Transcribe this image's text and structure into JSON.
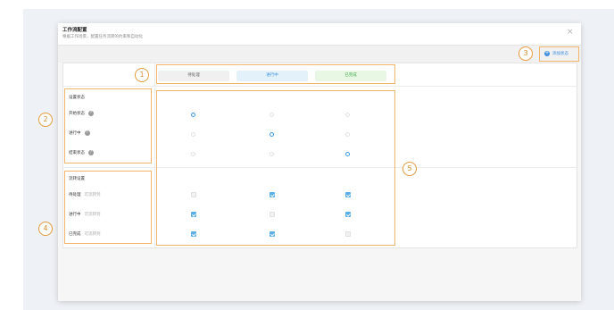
{
  "modal": {
    "title": "工作流配置",
    "subtitle": "根据工作场景，配置任务流转的约束和自动化",
    "close_label": "×"
  },
  "toolbar": {
    "add_status_label": "添加状态"
  },
  "statuses": [
    "待处理",
    "进行中",
    "已完成"
  ],
  "status_settings": {
    "heading": "设置状态",
    "rows": [
      {
        "label": "开始状态",
        "icon": "info-icon"
      },
      {
        "label": "进行中",
        "icon": "info-icon"
      },
      {
        "label": "结束状态",
        "icon": "info-icon"
      }
    ],
    "selected_index_per_row": [
      0,
      1,
      2
    ]
  },
  "transition_settings": {
    "heading": "流转设置",
    "rows": [
      {
        "label": "待处理",
        "hint": "可流转到",
        "checked": [
          false,
          true,
          true
        ]
      },
      {
        "label": "进行中",
        "hint": "可流转到",
        "checked": [
          true,
          false,
          true
        ]
      },
      {
        "label": "已完成",
        "hint": "可流转到",
        "checked": [
          true,
          true,
          false
        ]
      }
    ]
  },
  "annotations": [
    "1",
    "2",
    "3",
    "4",
    "5"
  ],
  "colors": {
    "accent": "#3b8de0",
    "annotation": "#f2b56b",
    "in_progress_bg": "#e3f1fb",
    "done_bg": "#e7f7e4"
  }
}
